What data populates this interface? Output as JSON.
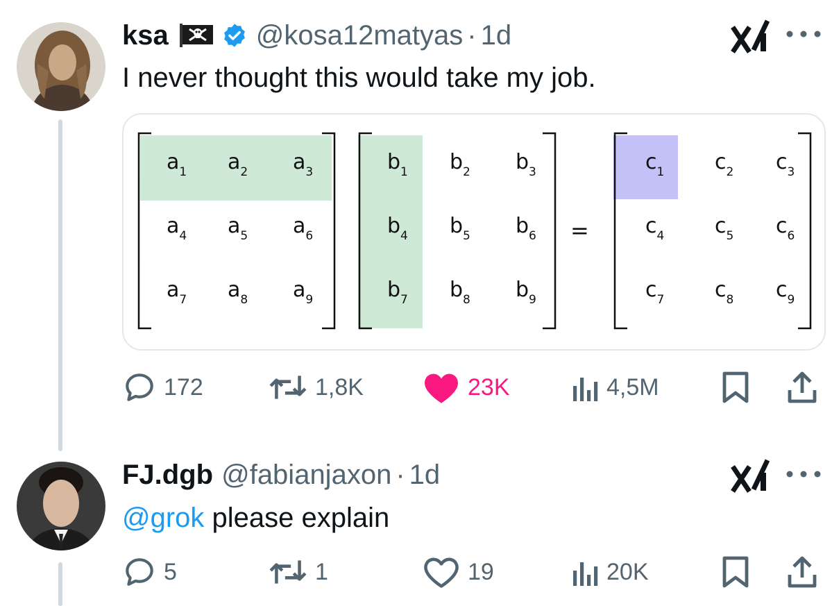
{
  "tweets": [
    {
      "name": "ksa",
      "flag_icon": "pirate-flag-icon",
      "verified": true,
      "handle": "@kosa12matyas",
      "separator": "·",
      "time": "1d",
      "text": "I never thought this would take my job.",
      "media": {
        "matrix_a": [
          "a1",
          "a2",
          "a3",
          "a4",
          "a5",
          "a6",
          "a7",
          "a8",
          "a9"
        ],
        "matrix_b": [
          "b1",
          "b2",
          "b3",
          "b4",
          "b5",
          "b6",
          "b7",
          "b8",
          "b9"
        ],
        "matrix_c": [
          "c1",
          "c2",
          "c3",
          "c4",
          "c5",
          "c6",
          "c7",
          "c8",
          "c9"
        ],
        "equals": "=",
        "highlight_green": "#cfe9d7",
        "highlight_blue": "#c3c1f7"
      },
      "stats": {
        "replies": "172",
        "reposts": "1,8K",
        "likes": "23K",
        "views": "4,5M"
      },
      "liked": true
    },
    {
      "name": "FJ.dgb",
      "handle": "@fabianjaxon",
      "separator": "·",
      "time": "1d",
      "mention": "@grok",
      "text": " please explain",
      "stats": {
        "replies": "5",
        "reposts": "1",
        "likes": "19",
        "views": "20K"
      },
      "liked": false
    }
  ],
  "colors": {
    "like": "#f91880",
    "link": "#1d9bf0",
    "muted": "#536471",
    "verified": "#1d9bf0"
  }
}
